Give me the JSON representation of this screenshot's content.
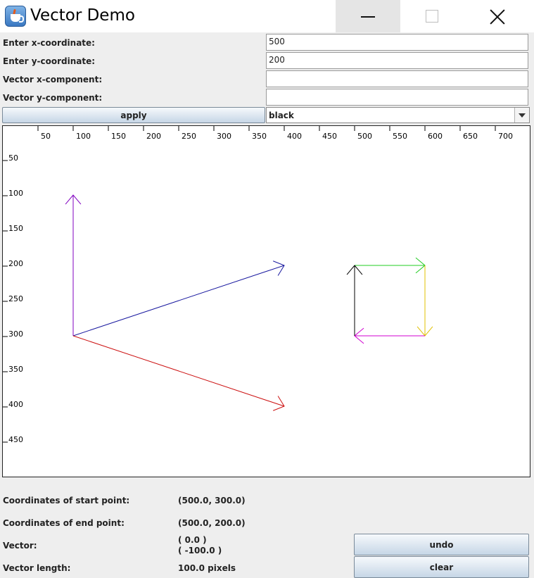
{
  "window": {
    "title": "Vector Demo"
  },
  "form": {
    "x_label": "Enter x-coordinate:",
    "x_value": "500",
    "y_label": "Enter y-coordinate:",
    "y_value": "200",
    "vx_label": "Vector x-component:",
    "vx_value": "",
    "vy_label": "Vector y-component:",
    "vy_value": "",
    "apply_label": "apply",
    "color_selected": "black"
  },
  "canvas": {
    "x_ticks": [
      "50",
      "100",
      "150",
      "200",
      "250",
      "300",
      "350",
      "400",
      "450",
      "500",
      "550",
      "600",
      "650",
      "700"
    ],
    "y_ticks": [
      "50",
      "100",
      "150",
      "200",
      "250",
      "300",
      "350",
      "400",
      "450"
    ],
    "vectors": [
      {
        "color": "#8000c0",
        "x1": 100,
        "y1": 300,
        "x2": 100,
        "y2": 100
      },
      {
        "color": "#1a1aa0",
        "x1": 100,
        "y1": 300,
        "x2": 400,
        "y2": 200
      },
      {
        "color": "#cc1010",
        "x1": 100,
        "y1": 300,
        "x2": 400,
        "y2": 400
      },
      {
        "color": "#22cc22",
        "x1": 500,
        "y1": 200,
        "x2": 600,
        "y2": 200
      },
      {
        "color": "#e0c000",
        "x1": 600,
        "y1": 200,
        "x2": 600,
        "y2": 300
      },
      {
        "color": "#d000d0",
        "x1": 600,
        "y1": 300,
        "x2": 500,
        "y2": 300
      },
      {
        "color": "#000000",
        "x1": 500,
        "y1": 300,
        "x2": 500,
        "y2": 200
      }
    ]
  },
  "info": {
    "start_label": "Coordinates of start point:",
    "start_value": "(500.0, 300.0)",
    "end_label": "Coordinates of end point:",
    "end_value": "(500.0, 200.0)",
    "vector_label": "Vector:",
    "vector_value_x": "( 0.0 )",
    "vector_value_y": "( -100.0 )",
    "length_label": "Vector length:",
    "length_value": "100.0 pixels",
    "undo_label": "undo",
    "clear_label": "clear"
  }
}
